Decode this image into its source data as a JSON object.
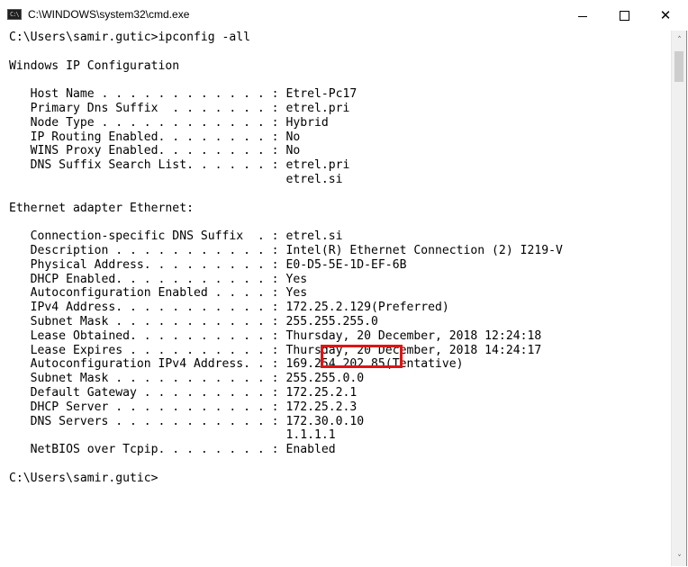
{
  "window": {
    "title": "C:\\WINDOWS\\system32\\cmd.exe",
    "icon_name": "cmd-console-icon",
    "icon_glyph": "C:\\"
  },
  "controls": {
    "minimize_icon": "minimize-icon",
    "maximize_icon": "maximize-icon",
    "close_glyph": "✕"
  },
  "console": {
    "lines": [
      "C:\\Users\\samir.gutic>ipconfig -all",
      "",
      "Windows IP Configuration",
      "",
      "   Host Name . . . . . . . . . . . . : Etrel-Pc17",
      "   Primary Dns Suffix  . . . . . . . : etrel.pri",
      "   Node Type . . . . . . . . . . . . : Hybrid",
      "   IP Routing Enabled. . . . . . . . : No",
      "   WINS Proxy Enabled. . . . . . . . : No",
      "   DNS Suffix Search List. . . . . . : etrel.pri",
      "                                       etrel.si",
      "",
      "Ethernet adapter Ethernet:",
      "",
      "   Connection-specific DNS Suffix  . : etrel.si",
      "   Description . . . . . . . . . . . : Intel(R) Ethernet Connection (2) I219-V",
      "   Physical Address. . . . . . . . . : E0-D5-5E-1D-EF-6B",
      "   DHCP Enabled. . . . . . . . . . . : Yes",
      "   Autoconfiguration Enabled . . . . : Yes",
      "   IPv4 Address. . . . . . . . . . . : 172.25.2.129(Preferred)",
      "   Subnet Mask . . . . . . . . . . . : 255.255.255.0",
      "   Lease Obtained. . . . . . . . . . : Thursday, 20 December, 2018 12:24:18",
      "   Lease Expires . . . . . . . . . . : Thursday, 20 December, 2018 14:24:17",
      "   Autoconfiguration IPv4 Address. . : 169.254.202.85(Tentative)",
      "   Subnet Mask . . . . . . . . . . . : 255.255.0.0",
      "   Default Gateway . . . . . . . . . : 172.25.2.1",
      "   DHCP Server . . . . . . . . . . . : 172.25.2.3",
      "   DNS Servers . . . . . . . . . . . : 172.30.0.10",
      "                                       1.1.1.1",
      "   NetBIOS over Tcpip. . . . . . . . : Enabled",
      "",
      "C:\\Users\\samir.gutic>"
    ],
    "annotation_color": "#e01414"
  },
  "scrollbar": {
    "up_glyph": "˄",
    "down_glyph": "˅"
  }
}
